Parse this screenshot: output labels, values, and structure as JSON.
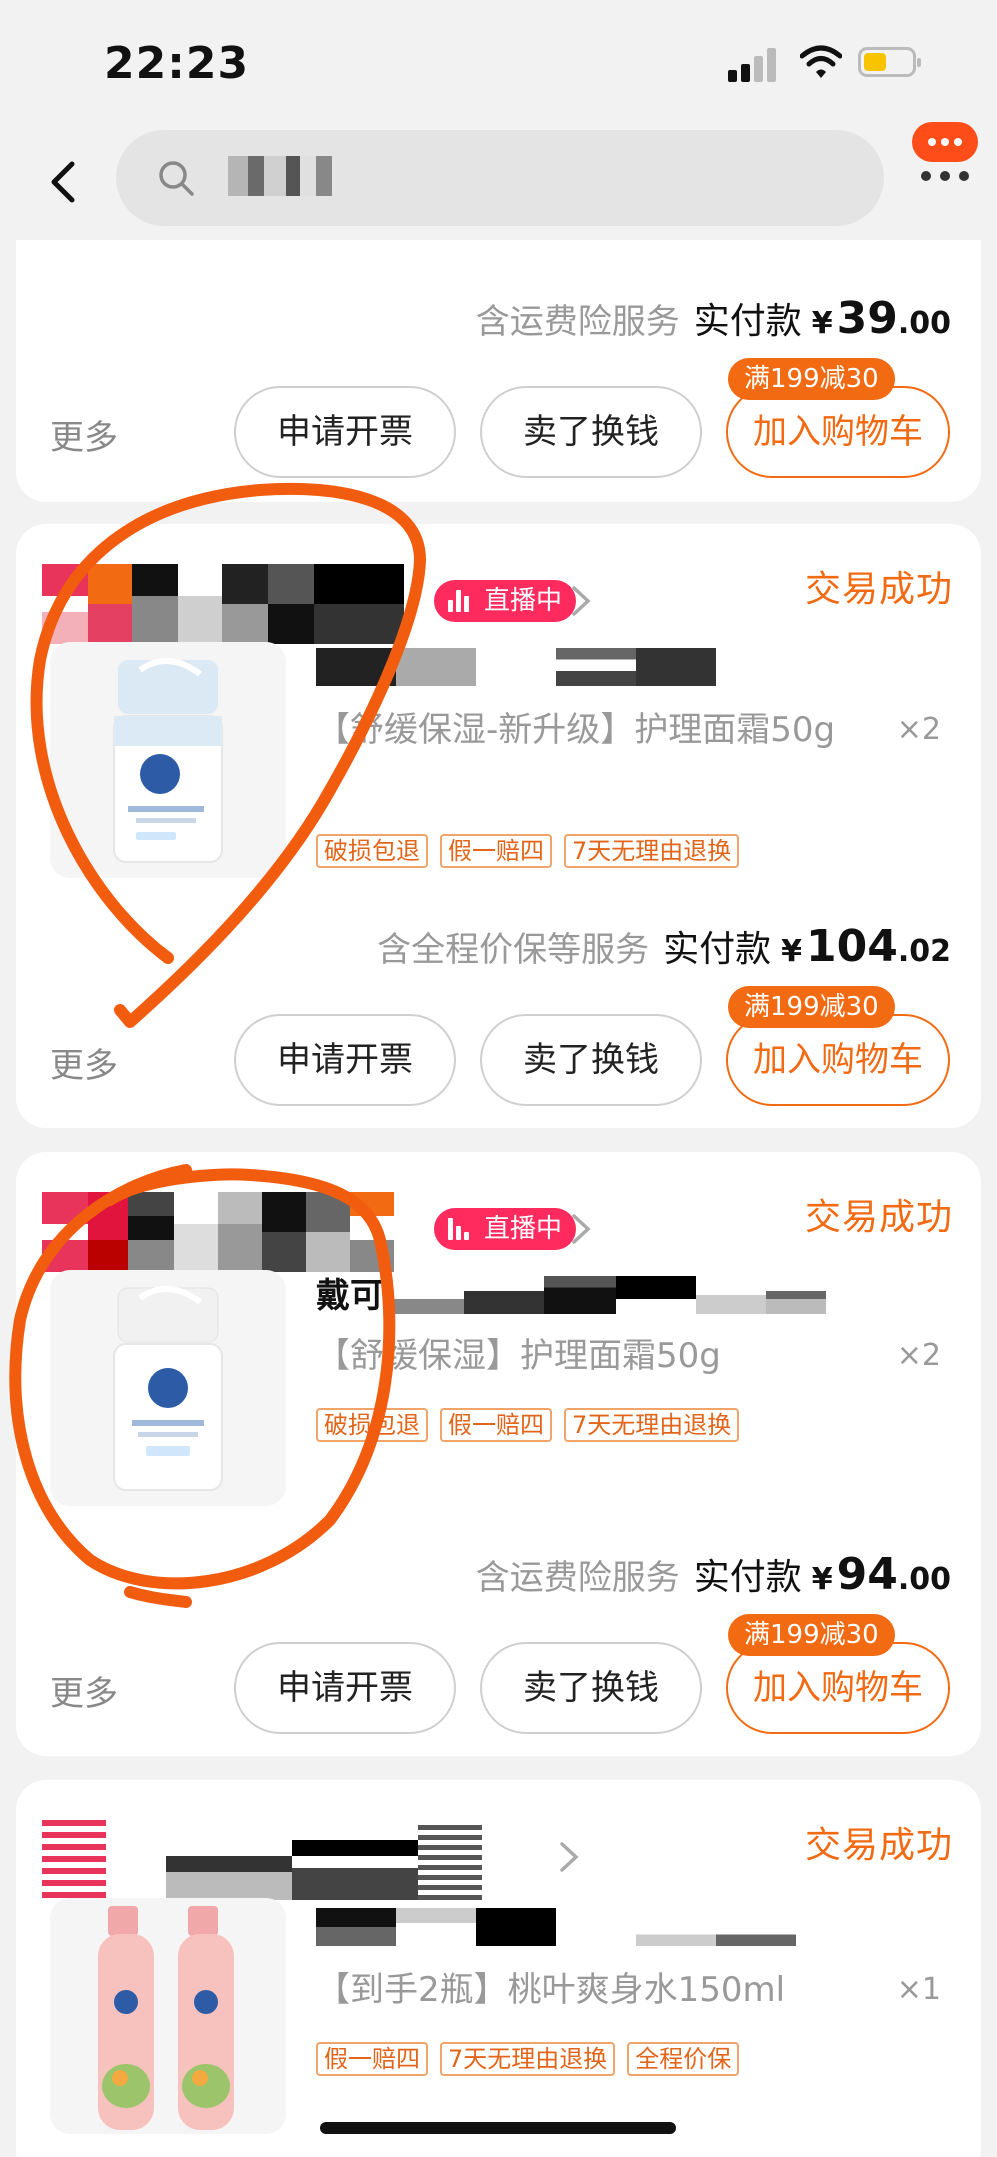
{
  "status_bar": {
    "time": "22:23"
  },
  "search": {
    "query": ""
  },
  "orders": [
    {
      "service_text": "含运费险服务",
      "paid_label": "实付款",
      "currency": "¥",
      "price_int": "39",
      "price_dec": ".00",
      "more": "更多",
      "invoice_btn": "申请开票",
      "sell_btn": "卖了换钱",
      "cart_btn": "加入购物车",
      "promo": "满199减30"
    },
    {
      "live_badge": "直播中",
      "status": "交易成功",
      "product_name": "【舒缓保湿-新升级】护理面霜50g",
      "quantity": "×2",
      "tags": [
        "破损包退",
        "假一赔四",
        "7天无理由退换"
      ],
      "service_text": "含全程价保等服务",
      "paid_label": "实付款",
      "currency": "¥",
      "price_int": "104",
      "price_dec": ".02",
      "more": "更多",
      "invoice_btn": "申请开票",
      "sell_btn": "卖了换钱",
      "cart_btn": "加入购物车",
      "promo": "满199减30"
    },
    {
      "live_badge": "直播中",
      "status": "交易成功",
      "brand_prefix": "戴可",
      "product_name": "【舒缓保湿】护理面霜50g",
      "quantity": "×2",
      "tags": [
        "破损包退",
        "假一赔四",
        "7天无理由退换"
      ],
      "service_text": "含运费险服务",
      "paid_label": "实付款",
      "currency": "¥",
      "price_int": "94",
      "price_dec": ".00",
      "more": "更多",
      "invoice_btn": "申请开票",
      "sell_btn": "卖了换钱",
      "cart_btn": "加入购物车",
      "promo": "满199减30"
    },
    {
      "status": "交易成功",
      "product_name": "【到手2瓶】桃叶爽身水150ml",
      "quantity": "×1",
      "tags": [
        "假一赔四",
        "7天无理由退换",
        "全程价保"
      ]
    }
  ],
  "product_brand": "戴可思",
  "colors": {
    "accent": "#f26a12",
    "live": "#ff2a5e",
    "annotation": "#f25c0f"
  }
}
